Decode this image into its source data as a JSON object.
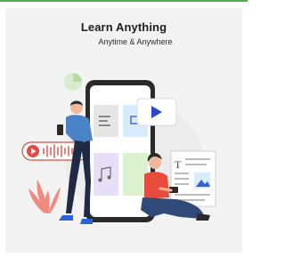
{
  "hero": {
    "title": "Learn Anything",
    "subtitle": "Anytime & Anywhere"
  },
  "icons": {
    "play": "play-icon",
    "audio": "audio-waveform-icon",
    "music": "music-note-icon",
    "document": "document-icon",
    "image": "image-icon",
    "pie": "pie-chart-icon"
  },
  "colors": {
    "accent_border": "#4caf50",
    "play_button": "#2b49c9",
    "audio_bubble": "#e04a45",
    "person_shirt": "#4a83c8",
    "woman_shirt": "#e64b3b",
    "tile_lavender": "#e6dff7",
    "tile_green": "#dcf2cf",
    "tile_blue": "#d9ebff"
  }
}
